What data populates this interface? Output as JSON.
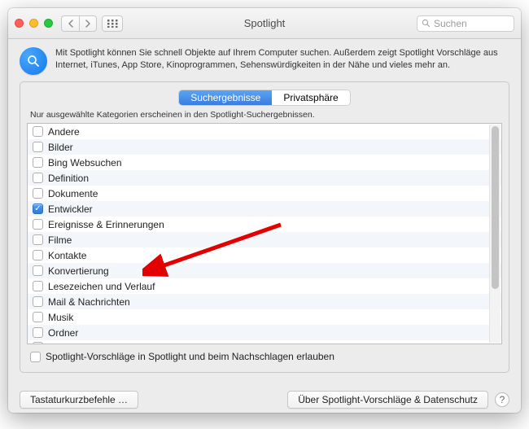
{
  "window": {
    "title": "Spotlight",
    "search_placeholder": "Suchen"
  },
  "header": {
    "description": "Mit Spotlight können Sie schnell Objekte auf Ihrem Computer suchen. Außerdem zeigt Spotlight Vorschläge aus Internet, iTunes, App Store, Kinoprogrammen, Sehenswürdigkeiten in der Nähe und vieles mehr an."
  },
  "tabs": {
    "search_results": "Suchergebnisse",
    "privacy": "Privatsphäre"
  },
  "hint": "Nur ausgewählte Kategorien erscheinen in den Spotlight-Suchergebnissen.",
  "categories": [
    {
      "label": "Andere",
      "checked": false
    },
    {
      "label": "Bilder",
      "checked": false
    },
    {
      "label": "Bing Websuchen",
      "checked": false
    },
    {
      "label": "Definition",
      "checked": false
    },
    {
      "label": "Dokumente",
      "checked": false
    },
    {
      "label": "Entwickler",
      "checked": true
    },
    {
      "label": "Ereignisse & Erinnerungen",
      "checked": false
    },
    {
      "label": "Filme",
      "checked": false
    },
    {
      "label": "Kontakte",
      "checked": false
    },
    {
      "label": "Konvertierung",
      "checked": false
    },
    {
      "label": "Lesezeichen und Verlauf",
      "checked": false
    },
    {
      "label": "Mail & Nachrichten",
      "checked": false
    },
    {
      "label": "Musik",
      "checked": false
    },
    {
      "label": "Ordner",
      "checked": false
    }
  ],
  "allow_suggestions": {
    "label": "Spotlight-Vorschläge in Spotlight und beim Nachschlagen erlauben",
    "checked": false
  },
  "footer": {
    "keyboard_shortcuts": "Tastaturkurzbefehle …",
    "about_privacy": "Über Spotlight-Vorschläge & Datenschutz"
  }
}
